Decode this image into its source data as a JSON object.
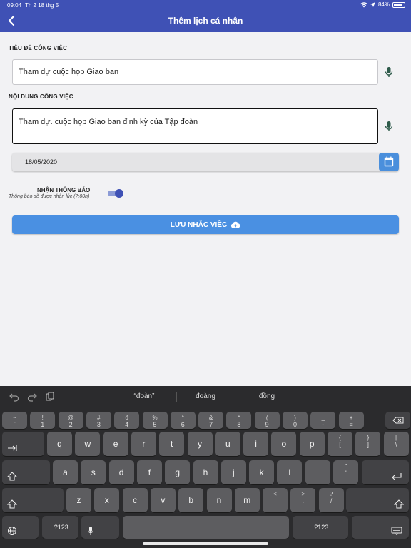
{
  "status_bar": {
    "time": "09:04",
    "date": "Th 2 18 thg 5",
    "battery": "84%",
    "battery_level": 0.84
  },
  "nav": {
    "title": "Thêm lịch cá nhân"
  },
  "form": {
    "title_label": "TIÊU ĐỀ CÔNG VIỆC",
    "title_value": "Tham dự cuộc họp Giao ban",
    "content_label": "NỘI DUNG CÔNG VIỆC",
    "content_value": "Tham dự. cuộc họp Giao ban định kỳ của Tập đoàn",
    "date_value": "18/05/2020",
    "notify_label": "NHẬN THÔNG BÁO",
    "notify_sub": "Thông báo sẽ được nhận lúc (7:00h)",
    "notify_on": true,
    "save_label": "LƯU NHẮC VIỆC"
  },
  "colors": {
    "primary": "#3f51b5",
    "button": "#4a90e2",
    "mic": "#2e5b4a"
  },
  "keyboard": {
    "suggestions": [
      "“đoàn”",
      "đoàng",
      "đồng"
    ],
    "row1": [
      {
        "top": "~",
        "bot": "`"
      },
      {
        "top": "!",
        "bot": "1"
      },
      {
        "top": "@",
        "bot": "2"
      },
      {
        "top": "#",
        "bot": "3"
      },
      {
        "top": "đ",
        "bot": "4"
      },
      {
        "top": "%",
        "bot": "5"
      },
      {
        "top": "^",
        "bot": "6"
      },
      {
        "top": "&",
        "bot": "7"
      },
      {
        "top": "*",
        "bot": "8"
      },
      {
        "top": "(",
        "bot": "9"
      },
      {
        "top": ")",
        "bot": "0"
      },
      {
        "top": "_",
        "bot": "-"
      },
      {
        "top": "+",
        "bot": "="
      }
    ],
    "row2": [
      "q",
      "w",
      "e",
      "r",
      "t",
      "y",
      "u",
      "i",
      "o",
      "p"
    ],
    "row2_extra": [
      {
        "top": "{",
        "bot": "["
      },
      {
        "top": "}",
        "bot": "]"
      },
      {
        "top": "|",
        "bot": "\\"
      }
    ],
    "row3": [
      "a",
      "s",
      "d",
      "f",
      "g",
      "h",
      "j",
      "k",
      "l"
    ],
    "row3_extra": [
      {
        "top": ":",
        "bot": ";"
      },
      {
        "top": "\"",
        "bot": "'"
      }
    ],
    "row4": [
      "z",
      "x",
      "c",
      "v",
      "b",
      "n",
      "m"
    ],
    "row4_extra": [
      {
        "top": "<",
        "bot": ","
      },
      {
        "top": ">",
        "bot": "."
      },
      {
        "top": "?",
        "bot": "/"
      }
    ],
    "num_label": ".?123"
  }
}
